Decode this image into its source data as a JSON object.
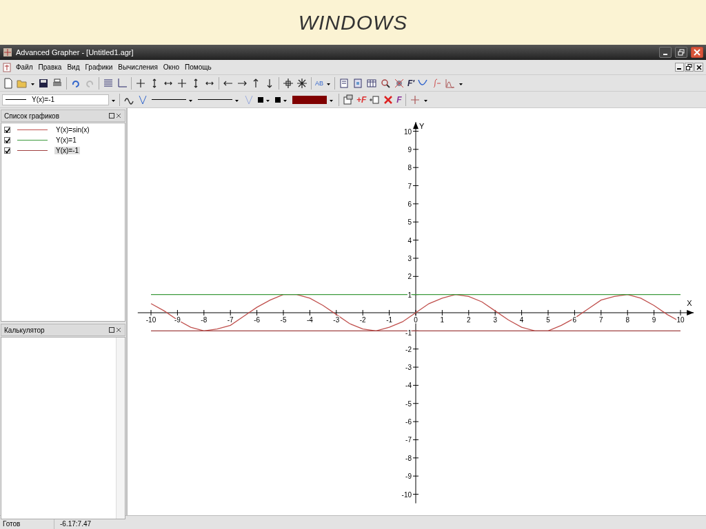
{
  "slide_title": "WINDOWS",
  "window": {
    "title": "Advanced Grapher - [Untitled1.agr]"
  },
  "menu": [
    "Файл",
    "Правка",
    "Вид",
    "Графики",
    "Вычисления",
    "Окно",
    "Помощь"
  ],
  "toolbar_1": {
    "text_buttons": [
      "AB",
      "F'"
    ]
  },
  "toolbar_2": {
    "graph_combo": "Y(x)=-1",
    "text_buttons": [
      "+F",
      "F"
    ]
  },
  "graph_list": {
    "title": "Список графиков",
    "items": [
      {
        "label": "Y(x)=sin(x)",
        "checked": true,
        "color": "#c0504d",
        "selected": false
      },
      {
        "label": "Y(x)=1",
        "checked": true,
        "color": "#3c9a3c",
        "selected": false
      },
      {
        "label": "Y(x)=-1",
        "checked": true,
        "color": "#a04040",
        "selected": true
      }
    ]
  },
  "calculator": {
    "title": "Калькулятор"
  },
  "plot": {
    "chart_data": {
      "type": "line",
      "xlabel": "X",
      "ylabel": "Y",
      "xlim": [
        -10.5,
        10.5
      ],
      "ylim": [
        -10.5,
        10.5
      ],
      "xticks": [
        -10,
        -9,
        -8,
        -7,
        -6,
        -5,
        -4,
        -3,
        -2,
        -1,
        0,
        1,
        2,
        3,
        4,
        5,
        6,
        7,
        8,
        9,
        10
      ],
      "yticks": [
        -10,
        -9,
        -8,
        -7,
        -6,
        -5,
        -4,
        -3,
        -2,
        -1,
        1,
        2,
        3,
        4,
        5,
        6,
        7,
        8,
        9,
        10
      ],
      "x": [
        -10,
        -9.5,
        -9,
        -8.5,
        -8,
        -7.5,
        -7,
        -6.5,
        -6,
        -5.5,
        -5,
        -4.5,
        -4,
        -3.5,
        -3,
        -2.5,
        -2,
        -1.5,
        -1,
        -0.5,
        0,
        0.5,
        1,
        1.5,
        2,
        2.5,
        3,
        3.5,
        4,
        4.5,
        5,
        5.5,
        6,
        6.5,
        7,
        7.5,
        8,
        8.5,
        9,
        9.5,
        10
      ],
      "series": [
        {
          "color": "#c0504d",
          "values": [
            0.5,
            0.1,
            -0.4,
            -0.8,
            -1,
            -0.9,
            -0.7,
            -0.2,
            0.3,
            0.7,
            1,
            1,
            0.8,
            0.4,
            -0.1,
            -0.6,
            -0.9,
            -1,
            -0.8,
            -0.5,
            0,
            0.5,
            0.8,
            1,
            0.9,
            0.6,
            0.1,
            -0.4,
            -0.8,
            -1,
            -1,
            -0.7,
            -0.3,
            0.2,
            0.7,
            0.9,
            1,
            0.8,
            0.4,
            -0.1,
            -0.5
          ]
        },
        {
          "color": "#3c9a3c",
          "values": [
            1,
            1,
            1,
            1,
            1,
            1,
            1,
            1,
            1,
            1,
            1,
            1,
            1,
            1,
            1,
            1,
            1,
            1,
            1,
            1,
            1,
            1,
            1,
            1,
            1,
            1,
            1,
            1,
            1,
            1,
            1,
            1,
            1,
            1,
            1,
            1,
            1,
            1,
            1,
            1,
            1
          ]
        },
        {
          "color": "#a04040",
          "values": [
            -1,
            -1,
            -1,
            -1,
            -1,
            -1,
            -1,
            -1,
            -1,
            -1,
            -1,
            -1,
            -1,
            -1,
            -1,
            -1,
            -1,
            -1,
            -1,
            -1,
            -1,
            -1,
            -1,
            -1,
            -1,
            -1,
            -1,
            -1,
            -1,
            -1,
            -1,
            -1,
            -1,
            -1,
            -1,
            -1,
            -1,
            -1,
            -1,
            -1,
            -1
          ]
        }
      ]
    }
  },
  "status_bar": [
    "Готов",
    "-6.17:7.47"
  ]
}
